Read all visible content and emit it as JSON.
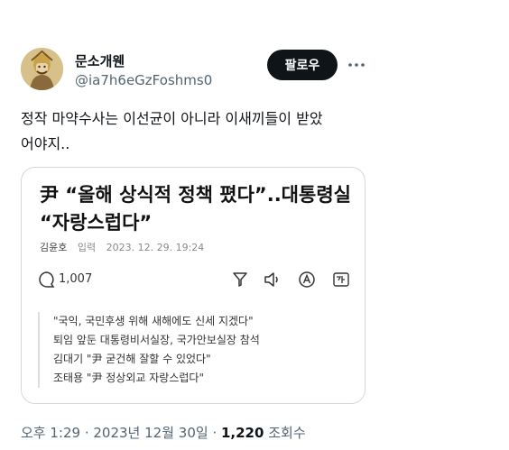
{
  "author": {
    "name": "문소개웬",
    "handle": "@ia7h6eGzFoshms0",
    "avatar_icon": "warrior-avatar"
  },
  "follow_button": "팔로우",
  "more_icon": "more-dots-icon",
  "tweet": {
    "lines": [
      "정작 마약수사는 이선균이 아니라 이새끼들이 받았",
      "어야지.."
    ]
  },
  "card": {
    "headline_lines": [
      "尹 “올해 상식적 정책 폈다”..대통령실",
      "“자랑스럽다”"
    ],
    "reporter": "김윤호",
    "input_label": "입력",
    "timestamp": "2023. 12. 29. 19:24",
    "comment_count": "1,007",
    "tools": [
      "summary-icon",
      "audio-icon",
      "font-size-icon",
      "translate-icon"
    ],
    "summary_lines": [
      "\"국익, 국민후생 위해 새해에도 신세 지겠다\"",
      "퇴임 앞둔 대통령비서실장, 국가안보실장 참석",
      "김대기 \"尹 굳건해 잘할 수 있었다\"",
      "조태용 \"尹 정상외교 자랑스럽다\""
    ]
  },
  "footer": {
    "time": "오후 1:29",
    "date": "2023년 12월 30일",
    "views_count": "1,220",
    "views_label": "조회수",
    "separator": " · "
  }
}
